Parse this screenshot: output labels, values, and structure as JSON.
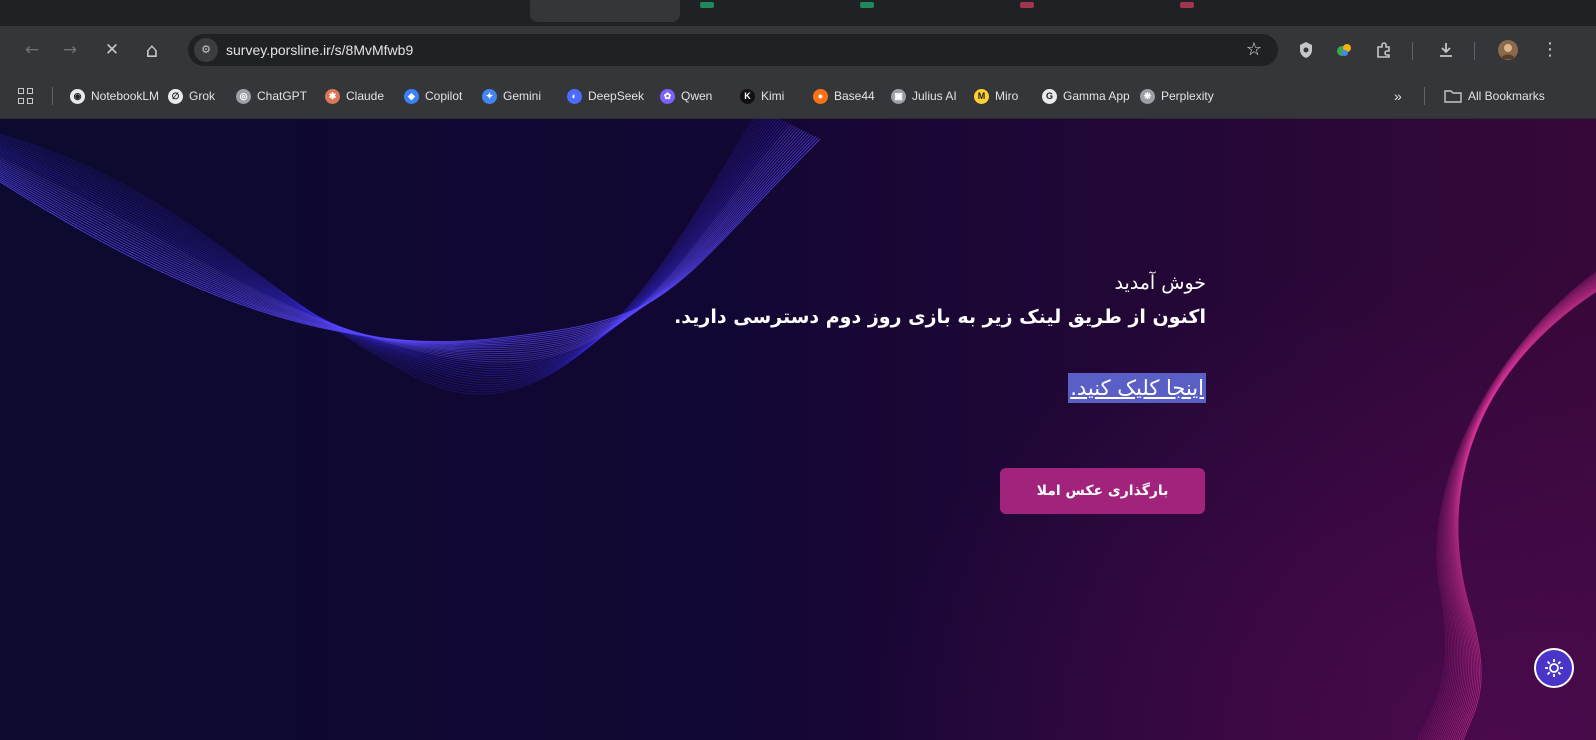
{
  "browser": {
    "url": "survey.porsline.ir/s/8MvMfwb9",
    "site_info_glyph": "⚙",
    "nav": {
      "back": "←",
      "forward": "→",
      "stop": "✕",
      "home": "⌂"
    },
    "star": "☆",
    "bookmarks": [
      {
        "label": "NotebookLM",
        "icon": "notebooklm-icon",
        "color": "#e8eaed"
      },
      {
        "label": "Grok",
        "icon": "grok-icon",
        "color": "#e8eaed"
      },
      {
        "label": "ChatGPT",
        "icon": "chatgpt-icon",
        "color": "#9aa0a6"
      },
      {
        "label": "Claude",
        "icon": "claude-icon",
        "color": "#d97757"
      },
      {
        "label": "Copilot",
        "icon": "copilot-icon",
        "color": "#3b82f6"
      },
      {
        "label": "Gemini",
        "icon": "gemini-icon",
        "color": "#4285f4"
      },
      {
        "label": "DeepSeek",
        "icon": "deepseek-icon",
        "color": "#4d6bfe"
      },
      {
        "label": "Qwen",
        "icon": "qwen-icon",
        "color": "#7b61ff"
      },
      {
        "label": "Kimi",
        "icon": "kimi-icon",
        "color": "#111111"
      },
      {
        "label": "Base44",
        "icon": "base44-icon",
        "color": "#f97316"
      },
      {
        "label": "Julius AI",
        "icon": "julius-icon",
        "color": "#9aa0a6"
      },
      {
        "label": "Miro",
        "icon": "miro-icon",
        "color": "#ffd02f"
      },
      {
        "label": "Gamma App",
        "icon": "gamma-icon",
        "color": "#e8eaed"
      },
      {
        "label": "Perplexity",
        "icon": "perplexity-icon",
        "color": "#9aa0a6"
      }
    ],
    "more_bookmarks": "»",
    "all_bookmarks": "All Bookmarks"
  },
  "page": {
    "welcome": "خوش آمدید",
    "subtitle": "اکنون از طریق لینک زیر به بازی روز دوم دسترسی دارید.",
    "link_text": "اینجا کلیک کنید.",
    "upload_button": "بارگذاری عکس املا",
    "colors": {
      "button": "#a2237c",
      "link_highlight": "#5a5fc6",
      "fab": "#4b35c9"
    }
  }
}
